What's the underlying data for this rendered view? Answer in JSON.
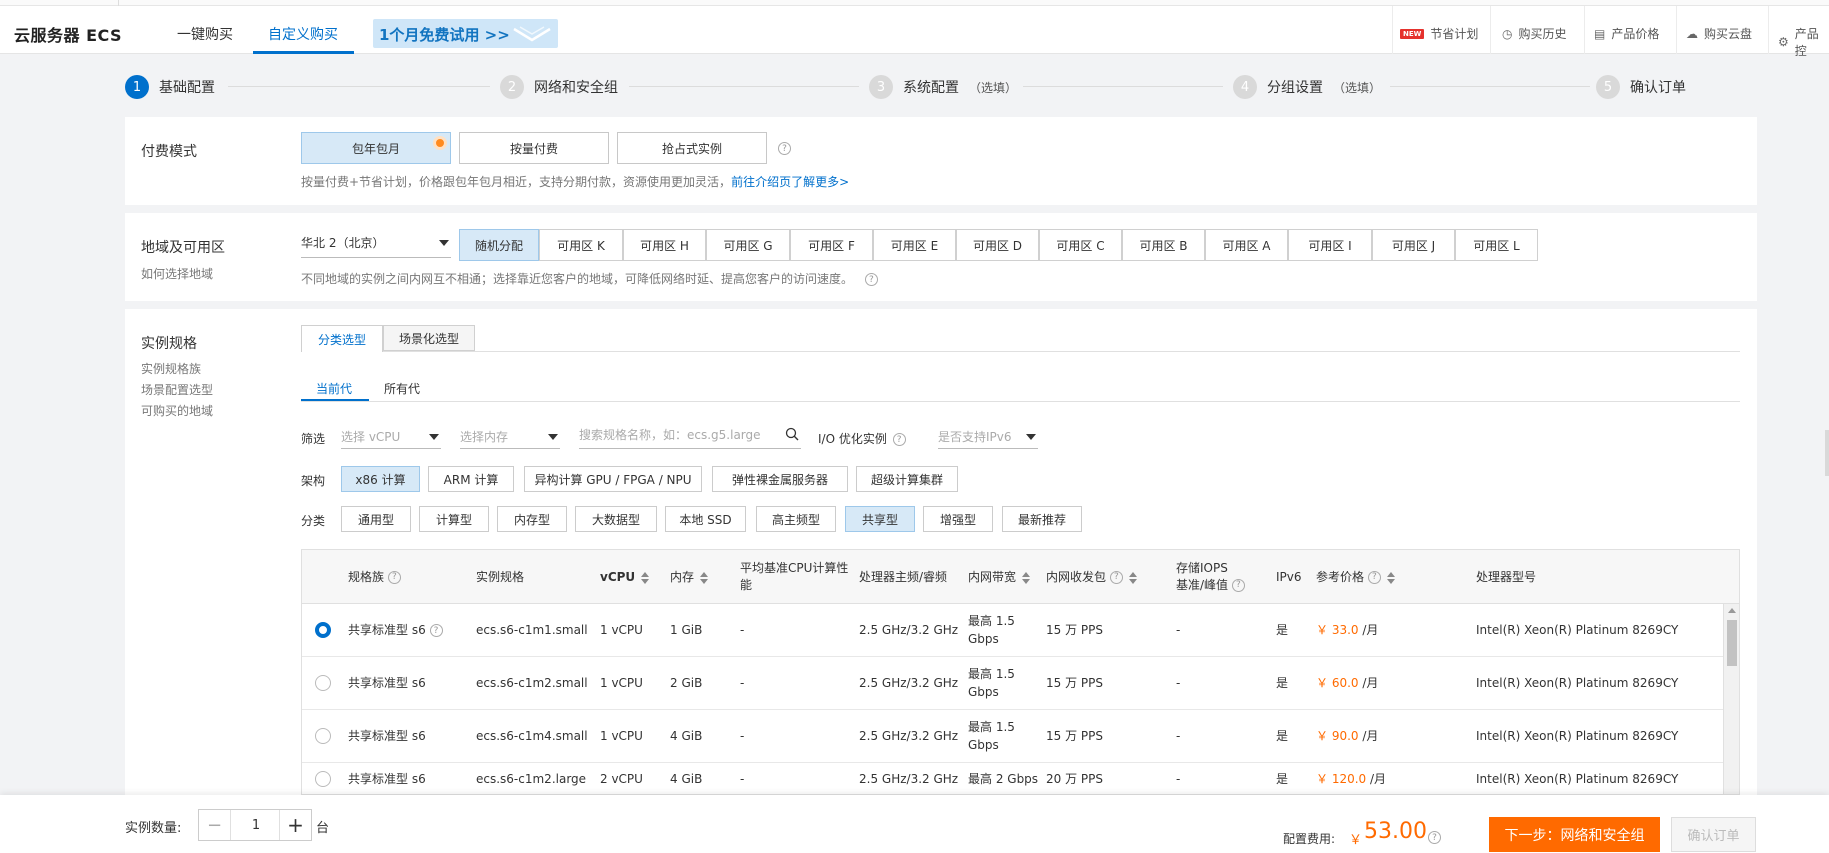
{
  "header": {
    "brand": "云服务器 ECS",
    "tabs": [
      {
        "label": "一键购买",
        "active": false
      },
      {
        "label": "自定义购买",
        "active": true
      }
    ],
    "promo": "1个月免费试用 >>",
    "right_nav": [
      {
        "label": "节省计划",
        "icon": "new-badge-icon",
        "badge": "NEW"
      },
      {
        "label": "购买历史",
        "icon": "clock-icon"
      },
      {
        "label": "产品价格",
        "icon": "document-icon"
      },
      {
        "label": "购买云盘",
        "icon": "cloud-icon"
      },
      {
        "label": "产品控",
        "icon": "gear-icon"
      }
    ]
  },
  "steps": [
    {
      "num": "1",
      "label": "基础配置",
      "optional": "",
      "active": true
    },
    {
      "num": "2",
      "label": "网络和安全组",
      "optional": "",
      "active": false
    },
    {
      "num": "3",
      "label": "系统配置",
      "optional": "（选填）",
      "active": false
    },
    {
      "num": "4",
      "label": "分组设置",
      "optional": "（选填）",
      "active": false
    },
    {
      "num": "5",
      "label": "确认订单",
      "optional": "",
      "active": false
    }
  ],
  "billing": {
    "label": "付费模式",
    "options": [
      "包年包月",
      "按量付费",
      "抢占式实例"
    ],
    "selected": "包年包月",
    "hint": "按量付费+节省计划，价格跟包年包月相近，支持分期付款，资源使用更加灵活，",
    "link": "前往介绍页了解更多>"
  },
  "region": {
    "label": "地域及可用区",
    "sublabel": "如何选择地域",
    "selected_region": "华北 2（北京）",
    "zones": [
      "随机分配",
      "可用区 K",
      "可用区 H",
      "可用区 G",
      "可用区 F",
      "可用区 E",
      "可用区 D",
      "可用区 C",
      "可用区 B",
      "可用区 A",
      "可用区 I",
      "可用区 J",
      "可用区 L"
    ],
    "selected_zone": "随机分配",
    "hint": "不同地域的实例之间内网互不相通；选择靠近您客户的地域，可降低网络时延、提高您客户的访问速度。"
  },
  "instance": {
    "label": "实例规格",
    "side_links": [
      "实例规格族",
      "场景配置选型",
      "可购买的地域"
    ],
    "tabs": [
      "分类选型",
      "场景化选型"
    ],
    "gen_tabs": [
      "当前代",
      "所有代"
    ],
    "filter_label": "筛选",
    "vcpu_placeholder": "选择 vCPU",
    "mem_placeholder": "选择内存",
    "search_placeholder": "搜索规格名称，如：ecs.g5.large",
    "io_label": "I/O 优化实例",
    "ipv6_placeholder": "是否支持IPv6",
    "arch_label": "架构",
    "arch_options": [
      "x86 计算",
      "ARM 计算",
      "异构计算 GPU / FPGA / NPU",
      "弹性裸金属服务器",
      "超级计算集群"
    ],
    "arch_selected": "x86 计算",
    "category_label": "分类",
    "categories": [
      "通用型",
      "计算型",
      "内存型",
      "大数据型",
      "本地 SSD",
      "高主频型",
      "共享型",
      "增强型",
      "最新推荐"
    ],
    "category_selected": "共享型"
  },
  "table": {
    "headers": {
      "family": "规格族",
      "spec": "实例规格",
      "vcpu": "vCPU",
      "mem": "内存",
      "cpu_base_1": "平均基准CPU计算性",
      "cpu_base_2": "能",
      "freq": "处理器主频/睿频",
      "bw": "内网带宽",
      "pps": "内网收发包",
      "iops_1": "存储IOPS",
      "iops_2": "基准/峰值",
      "ipv6": "IPv6",
      "price": "参考价格",
      "cpu_model": "处理器型号"
    },
    "rows": [
      {
        "family": "共享标准型 s6",
        "spec": "ecs.s6-c1m1.small",
        "vcpu": "1 vCPU",
        "mem": "1 GiB",
        "base": "-",
        "freq": "2.5 GHz/3.2 GHz",
        "bw_1": "最高 1.5",
        "bw_2": "Gbps",
        "pps": "15 万 PPS",
        "iops": "-",
        "ipv6": "是",
        "price": "￥ 33.0",
        "unit": "/月",
        "cpu": "Intel(R) Xeon(R) Platinum 8269CY",
        "selected": true
      },
      {
        "family": "共享标准型 s6",
        "spec": "ecs.s6-c1m2.small",
        "vcpu": "1 vCPU",
        "mem": "2 GiB",
        "base": "-",
        "freq": "2.5 GHz/3.2 GHz",
        "bw_1": "最高 1.5",
        "bw_2": "Gbps",
        "pps": "15 万 PPS",
        "iops": "-",
        "ipv6": "是",
        "price": "￥ 60.0",
        "unit": "/月",
        "cpu": "Intel(R) Xeon(R) Platinum 8269CY",
        "selected": false
      },
      {
        "family": "共享标准型 s6",
        "spec": "ecs.s6-c1m4.small",
        "vcpu": "1 vCPU",
        "mem": "4 GiB",
        "base": "-",
        "freq": "2.5 GHz/3.2 GHz",
        "bw_1": "最高 1.5",
        "bw_2": "Gbps",
        "pps": "15 万 PPS",
        "iops": "-",
        "ipv6": "是",
        "price": "￥ 90.0",
        "unit": "/月",
        "cpu": "Intel(R) Xeon(R) Platinum 8269CY",
        "selected": false
      },
      {
        "family": "共享标准型 s6",
        "spec": "ecs.s6-c1m2.large",
        "vcpu": "2 vCPU",
        "mem": "4 GiB",
        "base": "-",
        "freq": "2.5 GHz/3.2 GHz",
        "bw_1": "最高 2 Gbps",
        "bw_2": "",
        "pps": "20 万 PPS",
        "iops": "-",
        "ipv6": "是",
        "price": "￥ 120.0",
        "unit": "/月",
        "cpu": "Intel(R) Xeon(R) Platinum 8269CY",
        "selected": false
      }
    ]
  },
  "footer": {
    "qty_label": "实例数量:",
    "qty_value": "1",
    "qty_unit": "台",
    "fee_label": "配置费用:",
    "fee_currency": "￥",
    "fee_value": "53.00",
    "next_label": "下一步：网络和安全组",
    "confirm_label": "确认订单"
  },
  "colors": {
    "accent": "#0070cc",
    "price": "#ff6a00",
    "selected_bg": "#d7e9f7"
  }
}
